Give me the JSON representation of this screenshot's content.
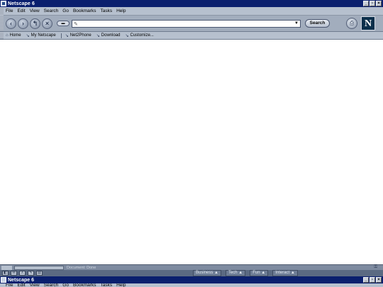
{
  "window": {
    "title": "Netscape 6"
  },
  "menu": [
    "File",
    "Edit",
    "View",
    "Search",
    "Go",
    "Bookmarks",
    "Tasks",
    "Help"
  ],
  "nav": {
    "back_icon": "back-arrow-icon",
    "forward_icon": "forward-arrow-icon",
    "reload_icon": "reload-icon",
    "stop_icon": "stop-icon",
    "search_label": "Search"
  },
  "personal_toolbar": [
    "Home",
    "My Netscape",
    "Net2Phone",
    "Download",
    "Customize..."
  ],
  "status": {
    "text": "Document: Done"
  },
  "taskbar_tabs": [
    "Business ▲",
    "Tech ▲",
    "Fun ▲",
    "Interact ▲"
  ],
  "second_window": {
    "title": "Netscape 6"
  }
}
